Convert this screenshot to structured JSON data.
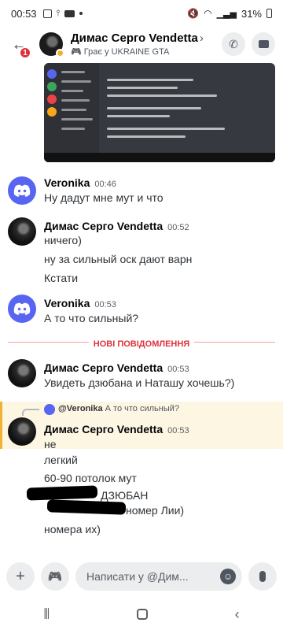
{
  "status_bar": {
    "time": "00:53",
    "battery": "31%"
  },
  "header": {
    "badge": "1",
    "name": "Димас Серго Vendetta",
    "activity": "Грає у UKRAINE GTA"
  },
  "messages": {
    "m1": {
      "author": "Veronika",
      "time": "00:46",
      "text": "Ну дадут мне мут и что"
    },
    "m2": {
      "author": "Димас Серго Vendetta",
      "time": "00:52",
      "lines": [
        "ничего)",
        "ну за сильный оск дают варн",
        "Кстати"
      ]
    },
    "m3": {
      "author": "Veronika",
      "time": "00:53",
      "text": "А то что сильный?"
    },
    "divider": "НОВІ ПОВІДОМЛЕННЯ",
    "m4": {
      "author": "Димас Серго Vendetta",
      "time": "00:53",
      "text": "Увидеть дзюбана и Наташу хочешь?)"
    },
    "reply": {
      "mention": "@Veronika",
      "quote": "А то что сильный?"
    },
    "m5": {
      "author": "Димас Серго Vendetta",
      "time": "00:53",
      "lines": [
        "не",
        "легкий",
        "60-90 потолок мут",
        "ДЗЮБАН",
        "номер Лии)",
        "номера их)"
      ]
    }
  },
  "composer": {
    "placeholder": "Написати у @Дим..."
  },
  "icons": {
    "back": "arrow-left-icon",
    "call": "phone-icon",
    "video": "video-icon",
    "add": "plus-icon",
    "gamepad": "gamepad-icon",
    "emoji": "emoji-icon",
    "mic": "mic-icon"
  },
  "colors": {
    "discord_blurple": "#5865f2",
    "new_messages": "#e0313b",
    "idle_status": "#f0b232",
    "highlight_bg": "#fdf6e3"
  }
}
